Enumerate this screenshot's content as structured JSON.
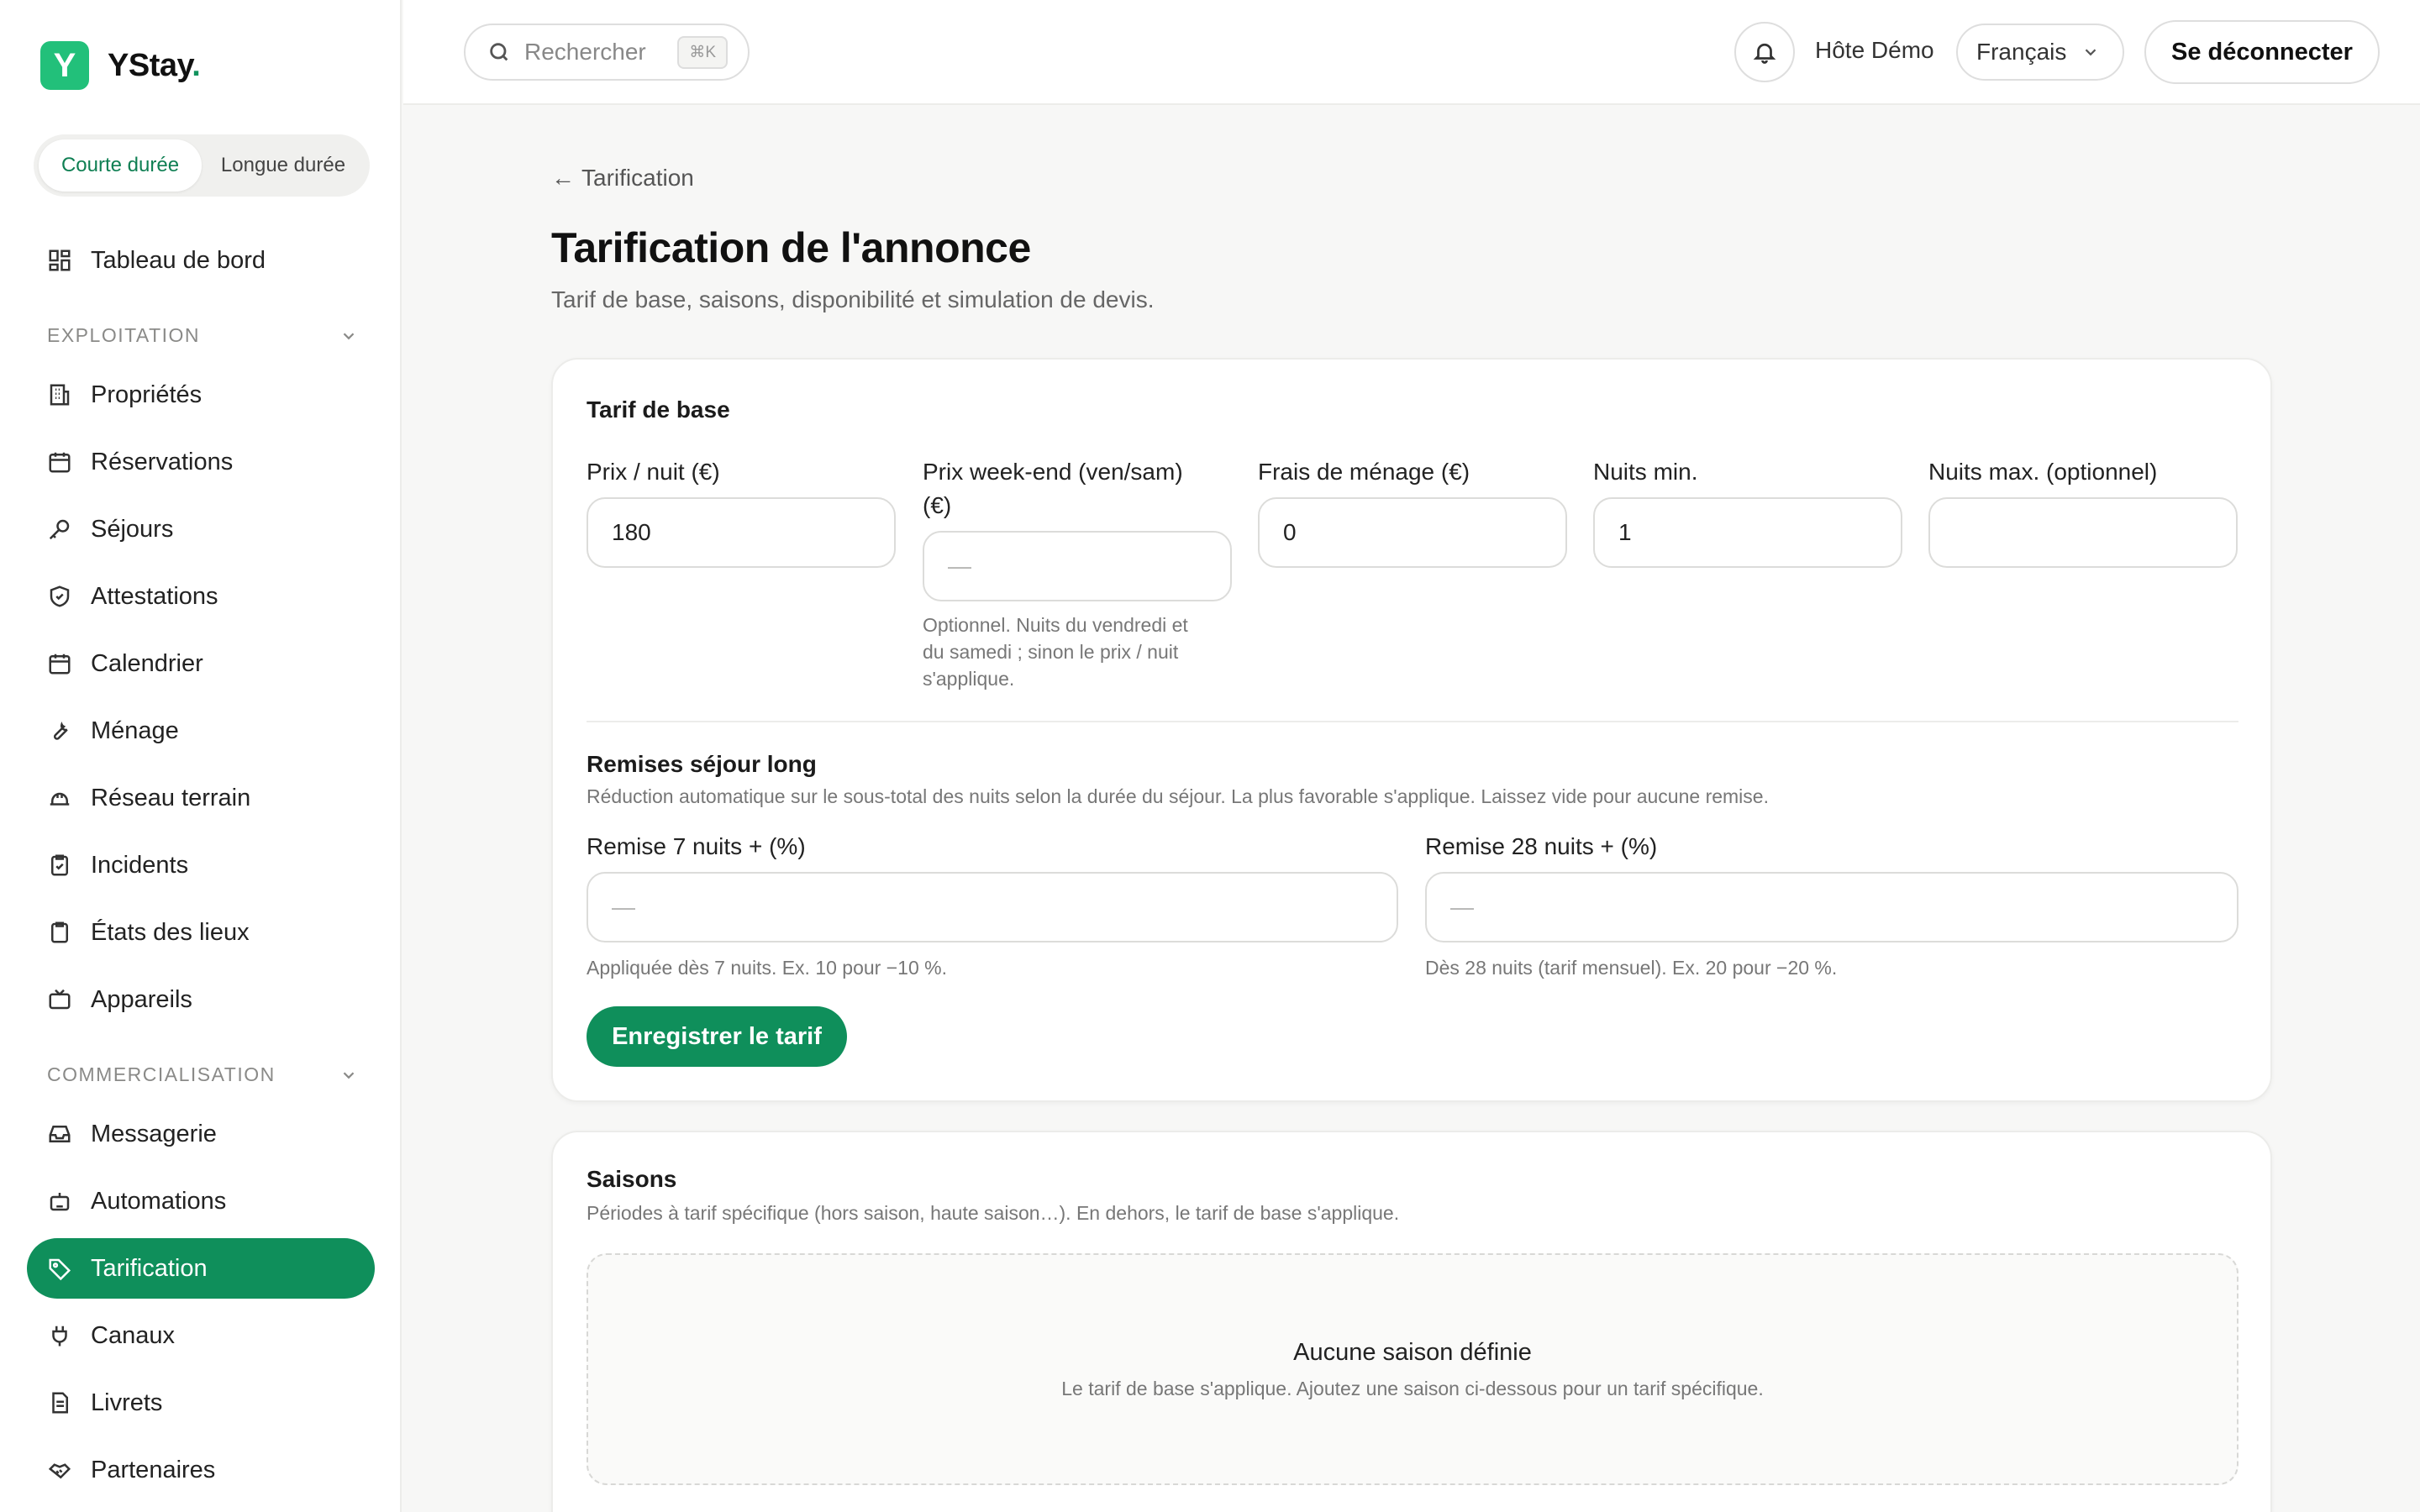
{
  "brand": {
    "logo_letter": "Y",
    "name": "YStay",
    "dot": "."
  },
  "mode_switch": {
    "short": "Courte durée",
    "long": "Longue durée"
  },
  "sidebar": {
    "dashboard": "Tableau de bord",
    "section_ops": "EXPLOITATION",
    "ops_items": [
      "Propriétés",
      "Réservations",
      "Séjours",
      "Attestations",
      "Calendrier",
      "Ménage",
      "Réseau terrain",
      "Incidents",
      "États des lieux",
      "Appareils"
    ],
    "section_com": "COMMERCIALISATION",
    "com_items": [
      "Messagerie",
      "Automations",
      "Tarification",
      "Canaux",
      "Livrets",
      "Partenaires"
    ]
  },
  "topbar": {
    "search_placeholder": "Rechercher",
    "search_shortcut": "⌘K",
    "host_name": "Hôte Démo",
    "language": "Français",
    "logout": "Se déconnecter"
  },
  "breadcrumb": {
    "arrow": "←",
    "label": "Tarification"
  },
  "page": {
    "title": "Tarification de l'annonce",
    "subtitle": "Tarif de base, saisons, disponibilité et simulation de devis."
  },
  "base_rate": {
    "title": "Tarif de base",
    "price_label": "Prix / nuit (€)",
    "price_value": "180",
    "weekend_label_1": "Prix week-end (ven/sam)",
    "weekend_label_2": "(€)",
    "weekend_placeholder": "—",
    "weekend_hint_1": "Optionnel. Nuits du vendredi et",
    "weekend_hint_2": "du samedi ; sinon le prix / nuit",
    "weekend_hint_3": "s'applique.",
    "cleaning_label": "Frais de ménage (€)",
    "cleaning_value": "0",
    "min_label": "Nuits min.",
    "min_value": "1",
    "max_label": "Nuits max. (optionnel)",
    "max_value": "",
    "discount_title": "Remises séjour long",
    "discount_sub": "Réduction automatique sur le sous-total des nuits selon la durée du séjour. La plus favorable s'applique. Laissez vide pour aucune remise.",
    "d7_label": "Remise 7 nuits + (%)",
    "d7_placeholder": "—",
    "d7_hint": "Appliquée dès 7 nuits. Ex. 10 pour −10 %.",
    "d28_label": "Remise 28 nuits + (%)",
    "d28_placeholder": "—",
    "d28_hint": "Dès 28 nuits (tarif mensuel). Ex. 20 pour −20 %.",
    "save": "Enregistrer le tarif"
  },
  "seasons": {
    "title": "Saisons",
    "subtitle": "Périodes à tarif spécifique (hors saison, haute saison…). En dehors, le tarif de base s'applique.",
    "empty_title": "Aucune saison définie",
    "empty_sub": "Le tarif de base s'applique. Ajoutez une saison ci-dessous pour un tarif spécifique."
  },
  "colors": {
    "accent": "#0f8f5b",
    "logo": "#22c07a"
  }
}
